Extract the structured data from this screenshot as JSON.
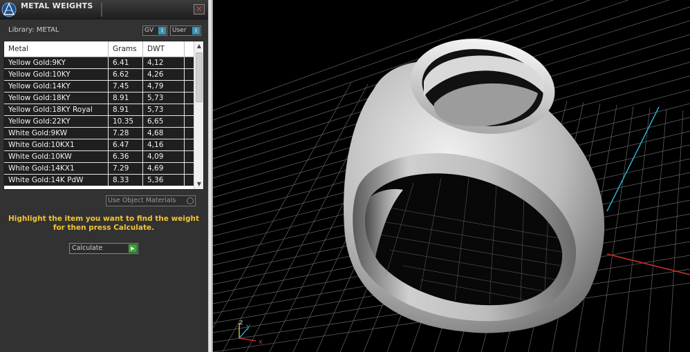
{
  "panel": {
    "title": "METAL WEIGHTS",
    "close_symbol": "✕",
    "library_label": "Library: METAL",
    "toggles": [
      {
        "label": "GV",
        "state": "I"
      },
      {
        "label": "User",
        "state": "I"
      }
    ],
    "columns": [
      "Metal",
      "Grams",
      "DWT"
    ],
    "rows": [
      {
        "metal": "Yellow Gold:9KY",
        "grams": "6.41",
        "dwt": "4,12"
      },
      {
        "metal": "Yellow Gold:10KY",
        "grams": "6.62",
        "dwt": "4,26"
      },
      {
        "metal": "Yellow Gold:14KY",
        "grams": "7.45",
        "dwt": "4,79"
      },
      {
        "metal": "Yellow Gold:18KY",
        "grams": "8.91",
        "dwt": "5,73"
      },
      {
        "metal": "Yellow Gold:18KY Royal",
        "grams": "8.91",
        "dwt": "5,73"
      },
      {
        "metal": "Yellow Gold:22KY",
        "grams": "10.35",
        "dwt": "6,65"
      },
      {
        "metal": "White Gold:9KW",
        "grams": "7.28",
        "dwt": "4,68"
      },
      {
        "metal": "White Gold:10KX1",
        "grams": "6.47",
        "dwt": "4,16"
      },
      {
        "metal": "White Gold:10KW",
        "grams": "6.36",
        "dwt": "4,09"
      },
      {
        "metal": "White Gold:14KX1",
        "grams": "7.29",
        "dwt": "4,69"
      },
      {
        "metal": "White Gold:14K PdW",
        "grams": "8.33",
        "dwt": "5,36"
      }
    ],
    "use_materials_label": "Use Object Materials",
    "hint": "Highlight the item you want to find the weight for then press Calculate.",
    "calculate_label": "Calculate"
  },
  "viewport": {
    "axis_labels": {
      "z": "z",
      "y": "y",
      "x": "x"
    },
    "colors": {
      "x_axis": "#c4302b",
      "y_axis": "#2fa6c4",
      "grid": "#8a8a8a",
      "z_axis": "#d8c24a"
    }
  }
}
